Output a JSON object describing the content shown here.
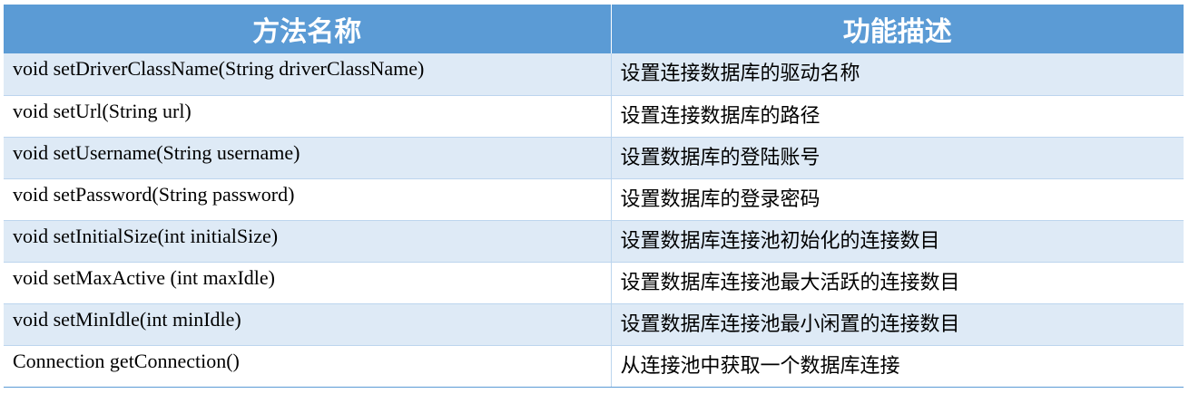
{
  "header": {
    "method_name": "方法名称",
    "description": "功能描述"
  },
  "rows": [
    {
      "method": "void setDriverClassName(String driverClassName)",
      "desc": "设置连接数据库的驱动名称"
    },
    {
      "method": "void setUrl(String url)",
      "desc": "设置连接数据库的路径"
    },
    {
      "method": "void setUsername(String username)",
      "desc": "设置数据库的登陆账号"
    },
    {
      "method": "void setPassword(String password)",
      "desc": "设置数据库的登录密码"
    },
    {
      "method": "void setInitialSize(int initialSize)",
      "desc": "设置数据库连接池初始化的连接数目"
    },
    {
      "method": "void setMaxActive (int maxIdle)",
      "desc": "设置数据库连接池最大活跃的连接数目"
    },
    {
      "method": "void setMinIdle(int minIdle)",
      "desc": "设置数据库连接池最小闲置的连接数目"
    },
    {
      "method": "Connection getConnection()",
      "desc": "从连接池中获取一个数据库连接"
    }
  ]
}
